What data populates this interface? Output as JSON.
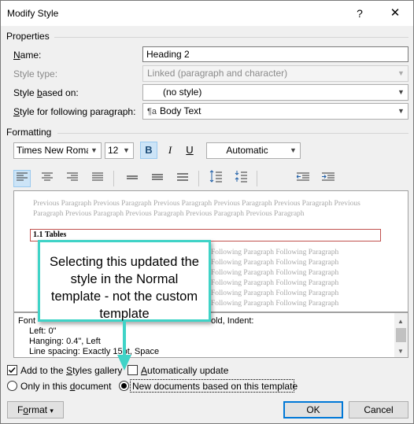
{
  "window": {
    "title": "Modify Style",
    "help_label": "?",
    "close_label": "✕"
  },
  "properties": {
    "section_label": "Properties",
    "name_label_key": "N",
    "name_label_rest": "ame:",
    "name_value": "Heading 2",
    "style_type_label": "Style type:",
    "style_type_value": "Linked (paragraph and character)",
    "based_on_label_pre": "Style ",
    "based_on_label_key": "b",
    "based_on_label_rest": "ased on:",
    "based_on_value": "(no style)",
    "following_label_key": "S",
    "following_label_rest": "tyle for following paragraph:",
    "following_value": "Body Text",
    "following_icon": "paragraph-style-icon"
  },
  "formatting": {
    "section_label": "Formatting",
    "font_name": "Times New Roman",
    "font_size": "12",
    "bold_label": "B",
    "italic_label": "I",
    "underline_label": "U",
    "color_value": "Automatic"
  },
  "preview": {
    "previous_line_1": "Previous Paragraph Previous Paragraph Previous Paragraph Previous Paragraph Previous Paragraph Previous",
    "previous_line_2": "Paragraph Previous Paragraph Previous Paragraph Previous Paragraph Previous Paragraph",
    "heading_text": "1.1    Tables",
    "following_line": "Following Paragraph Following Paragraph"
  },
  "description": {
    "line1_start": "Font",
    "line1_end": "old, Indent:",
    "line2": "Left:  0\"",
    "line3": "Hanging:  0.4\", Left",
    "line4_start": "Line spacing:  Exactly 15",
    "line4_end": "pt, Space"
  },
  "options": {
    "add_gallery_pre": "Add to the ",
    "add_gallery_key": "S",
    "add_gallery_rest": "tyles gallery",
    "add_gallery_checked": true,
    "auto_update_key": "A",
    "auto_update_rest": "utomatically update",
    "auto_update_checked": false,
    "only_doc_pre": "Only in this ",
    "only_doc_key": "d",
    "only_doc_rest": "ocument",
    "new_docs_label": "New documents based on this template",
    "selected_scope": "new_documents"
  },
  "buttons": {
    "format_key": "o",
    "format_pre": "F",
    "format_rest": "rmat",
    "format_arrow": "▾",
    "ok_label": "OK",
    "cancel_label": "Cancel"
  },
  "callout": {
    "text": "Selecting this updated the style in the Normal template - not the custom template",
    "border_color": "#3fd3c7"
  },
  "colors": {
    "accent_blue": "#0078d7",
    "heading_border": "#c0504d",
    "selected_button_bg": "#cce4f7"
  }
}
